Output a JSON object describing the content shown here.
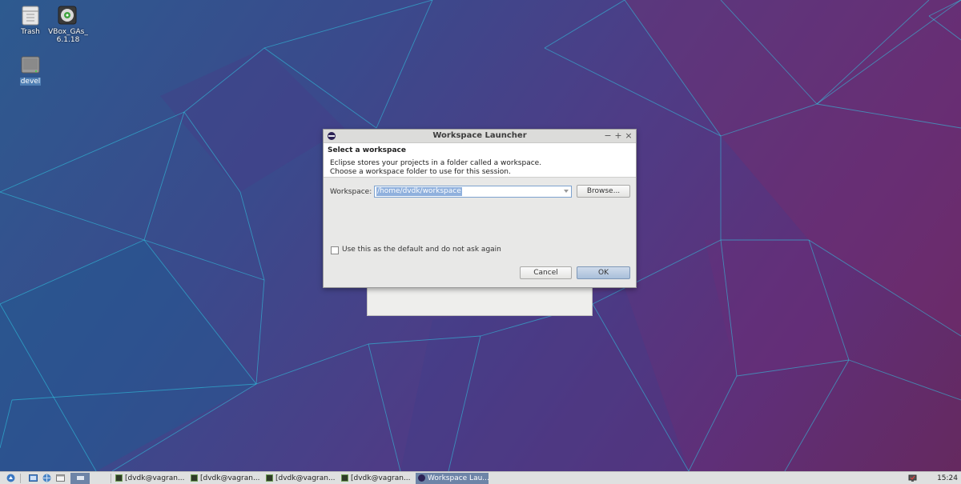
{
  "desktop": {
    "icons": [
      {
        "label": "Trash"
      },
      {
        "label": "VBox_GAs_6.1.18"
      },
      {
        "label": "devel"
      }
    ]
  },
  "dialog": {
    "title": "Workspace Launcher",
    "controls": {
      "minimize": "−",
      "maximize": "+",
      "close": "×"
    },
    "header": {
      "title": "Select a workspace",
      "description_line1": "Eclipse stores your projects in a folder called a workspace.",
      "description_line2": "Choose a workspace folder to use for this session."
    },
    "workspace": {
      "label": "Workspace:",
      "value": "/home/dvdk/workspace"
    },
    "browse_label": "Browse...",
    "default_checkbox": {
      "label": "Use this as the default and do not ask again",
      "checked": false
    },
    "cancel_label": "Cancel",
    "ok_label": "OK"
  },
  "taskbar": {
    "tasks": [
      {
        "label": "[dvdk@vagran...",
        "icon": "terminal-icon"
      },
      {
        "label": "[dvdk@vagran...",
        "icon": "terminal-icon"
      },
      {
        "label": "[dvdk@vagran...",
        "icon": "terminal-icon"
      },
      {
        "label": "[dvdk@vagran...",
        "icon": "terminal-icon"
      },
      {
        "label": "Workspace Lau...",
        "icon": "eclipse-icon",
        "active": true
      }
    ],
    "clock": "15:24"
  },
  "colors": {
    "accent": "#6d84a7",
    "selection": "#8fb0dd",
    "wallpaper_lines": "#2fd0e8"
  }
}
